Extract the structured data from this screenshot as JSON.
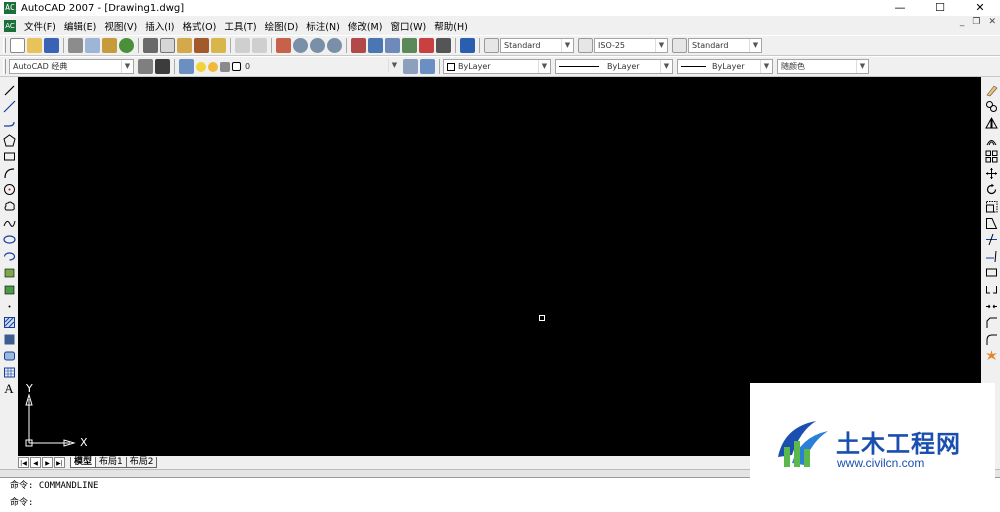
{
  "window": {
    "icon_text": "AC",
    "title": "AutoCAD 2007 - [Drawing1.dwg]",
    "minimize": "—",
    "maximize": "☐",
    "close": "✕"
  },
  "menubar": {
    "icon_text": "AC",
    "items": [
      "文件(F)",
      "编辑(E)",
      "视图(V)",
      "插入(I)",
      "格式(O)",
      "工具(T)",
      "绘图(D)",
      "标注(N)",
      "修改(M)",
      "窗口(W)",
      "帮助(H)"
    ],
    "doc_minimize": "_",
    "doc_restore": "❐",
    "doc_close": "✕"
  },
  "toolbar1": {
    "text_style": "Standard",
    "dim_style": "ISO-25",
    "table_style": "Standard"
  },
  "toolbar2": {
    "workspace": "AutoCAD 经典",
    "layer": "0",
    "color": "ByLayer",
    "linetype": "ByLayer",
    "lineweight": "ByLayer",
    "plotstyle": "随颜色"
  },
  "ucs": {
    "x_label": "X",
    "y_label": "Y"
  },
  "tabs": {
    "nav": [
      "|◀",
      "◀",
      "▶",
      "▶|"
    ],
    "items": [
      "模型",
      "布局1",
      "布局2"
    ]
  },
  "command": {
    "history": "命令: COMMANDLINE",
    "prompt": "命令:"
  },
  "watermark": {
    "name": "土木工程网",
    "url": "www.civilcn.com"
  },
  "colors": {
    "canvas": "#000000",
    "accent": "#1a4fb0"
  }
}
